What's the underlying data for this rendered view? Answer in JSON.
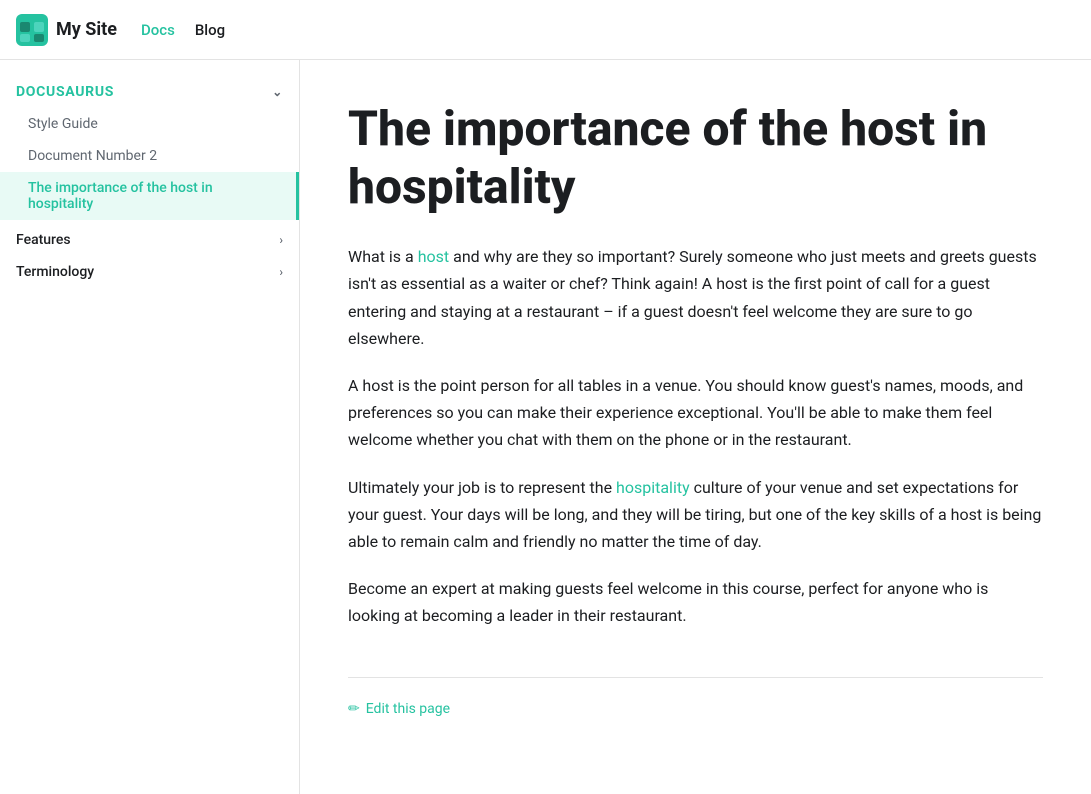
{
  "navbar": {
    "brand": "My Site",
    "logo_alt": "site-logo",
    "links": [
      {
        "label": "Docs",
        "active": true
      },
      {
        "label": "Blog",
        "active": false
      }
    ]
  },
  "sidebar": {
    "category_label": "Docusaurus",
    "items": [
      {
        "label": "Style Guide",
        "active": false
      },
      {
        "label": "Document Number 2",
        "active": false
      },
      {
        "label": "The importance of the host in hospitality",
        "active": true
      }
    ],
    "collapsible": [
      {
        "label": "Features"
      },
      {
        "label": "Terminology"
      }
    ]
  },
  "main": {
    "title": "The importance of the host in hospitality",
    "paragraphs": [
      {
        "id": "p1",
        "before_link": "What is a ",
        "link_text": "host",
        "after_link": " and why are they so important? Surely someone who just meets and greets guests isn't as essential as a waiter or chef? Think again! A host is the first point of call for a guest entering and staying at a restaurant – if a guest doesn't feel welcome they are sure to go elsewhere."
      },
      {
        "id": "p2",
        "text": "A host is the point person for all tables in a venue. You should know guest's names, moods, and preferences so you can make their experience exceptional. You'll be able to make them feel welcome whether you chat with them on the phone or in the restaurant."
      },
      {
        "id": "p3",
        "before_link": "Ultimately your job is to represent the ",
        "link_text": "hospitality",
        "after_link": " culture of your venue and set expectations for your guest. Your days will be long, and they will be tiring, but one of the key skills of a host is being able to remain calm and friendly no matter the time of day."
      },
      {
        "id": "p4",
        "text": "Become an expert at making guests feel welcome in this course, perfect for anyone who is looking at becoming a leader in their restaurant."
      }
    ],
    "edit_link_label": "Edit this page"
  }
}
